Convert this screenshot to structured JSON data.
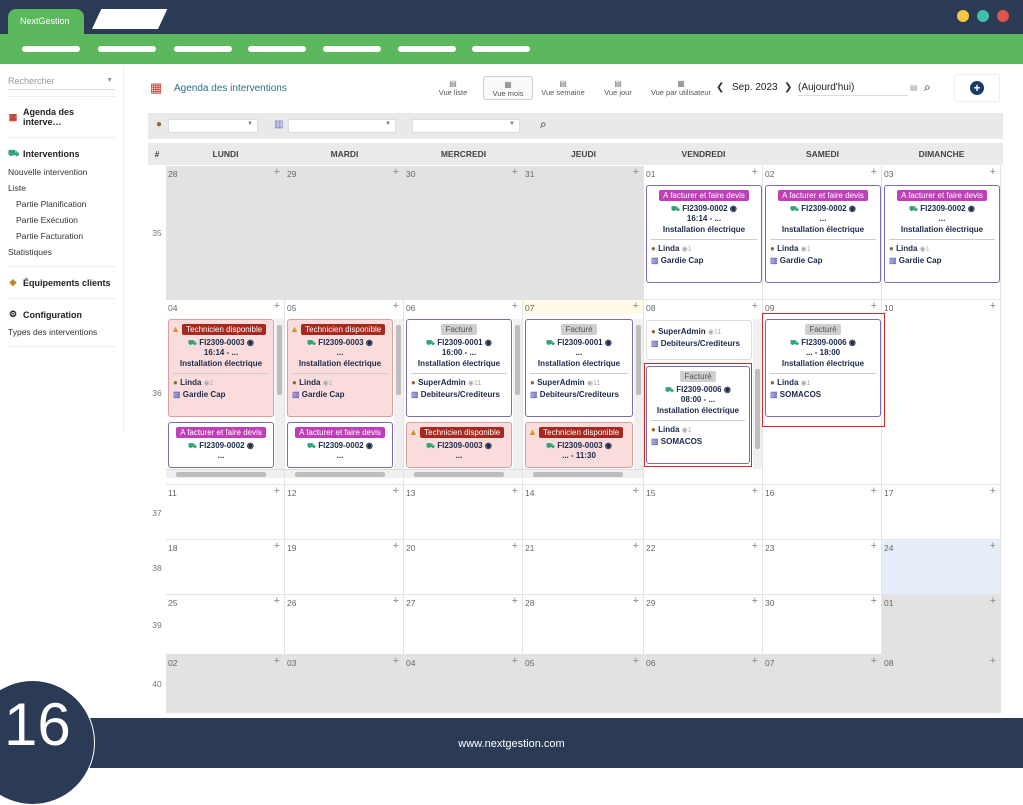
{
  "app": {
    "tab_label": "NextGestion",
    "footer_url": "www.nextgestion.com",
    "page_number": "16"
  },
  "sidebar": {
    "search_placeholder": "Rechercher",
    "agenda": "Agenda des interve…",
    "interventions": "Interventions",
    "new_intervention": "Nouvelle intervention",
    "list": "Liste",
    "planning": "Partie Planification",
    "execution": "Partie Exécution",
    "billing": "Partie Facturation",
    "stats": "Statistiques",
    "equipment": "Équipements clients",
    "config": "Configuration",
    "types": "Types des interventions"
  },
  "header": {
    "title": "Agenda des interventions",
    "views": [
      "Vue liste",
      "Vue mois",
      "Vue semaine",
      "Vue jour",
      "Vue par utilisateur"
    ],
    "month": "Sep. 2023",
    "today": "(Aujourd'hui)"
  },
  "days": [
    "#",
    "LUNDI",
    "MARDI",
    "MERCREDI",
    "JEUDI",
    "VENDREDI",
    "SAMEDI",
    "DIMANCHE"
  ],
  "weeks": [
    "35",
    "36",
    "37",
    "38",
    "39",
    "40"
  ],
  "dates": [
    [
      "28",
      "29",
      "30",
      "31",
      "01",
      "02",
      "03"
    ],
    [
      "04",
      "05",
      "06",
      "07",
      "08",
      "09",
      "10"
    ],
    [
      "11",
      "12",
      "13",
      "14",
      "15",
      "16",
      "17"
    ],
    [
      "18",
      "19",
      "20",
      "21",
      "22",
      "23",
      "24"
    ],
    [
      "25",
      "26",
      "27",
      "28",
      "29",
      "30",
      "01"
    ],
    [
      "02",
      "03",
      "04",
      "05",
      "06",
      "07",
      "08"
    ]
  ],
  "events": {
    "a_facturer": "A facturer et faire devis",
    "tech_dispo": "Technicien disponible",
    "facture": "Facturé",
    "fi0002": "FI2309-0002",
    "fi0003": "FI2309-0003",
    "fi0001": "FI2309-0001",
    "fi0006": "FI2309-0006",
    "t1614": "16:14 - ...",
    "t1600": "16:00 - ...",
    "t0800": "08:00 - ...",
    "t1800": "... - 18:00",
    "t1130": "... - 11:30",
    "dots": "...",
    "install": "Installation électrique",
    "linda": "Linda",
    "superadmin": "SuperAdmin",
    "gardie": "Gardie Cap",
    "debiteurs": "Debiteurs/Crediteurs",
    "somacos": "SOMACOS",
    "eye_count_1": "1",
    "eye_count_11": "11"
  },
  "colors": {
    "topbar": "#2b3a55",
    "green": "#5cb85c",
    "purple_badge": "#c03fb8",
    "red_badge": "#a6281e",
    "highlight": "#d42a2a"
  }
}
